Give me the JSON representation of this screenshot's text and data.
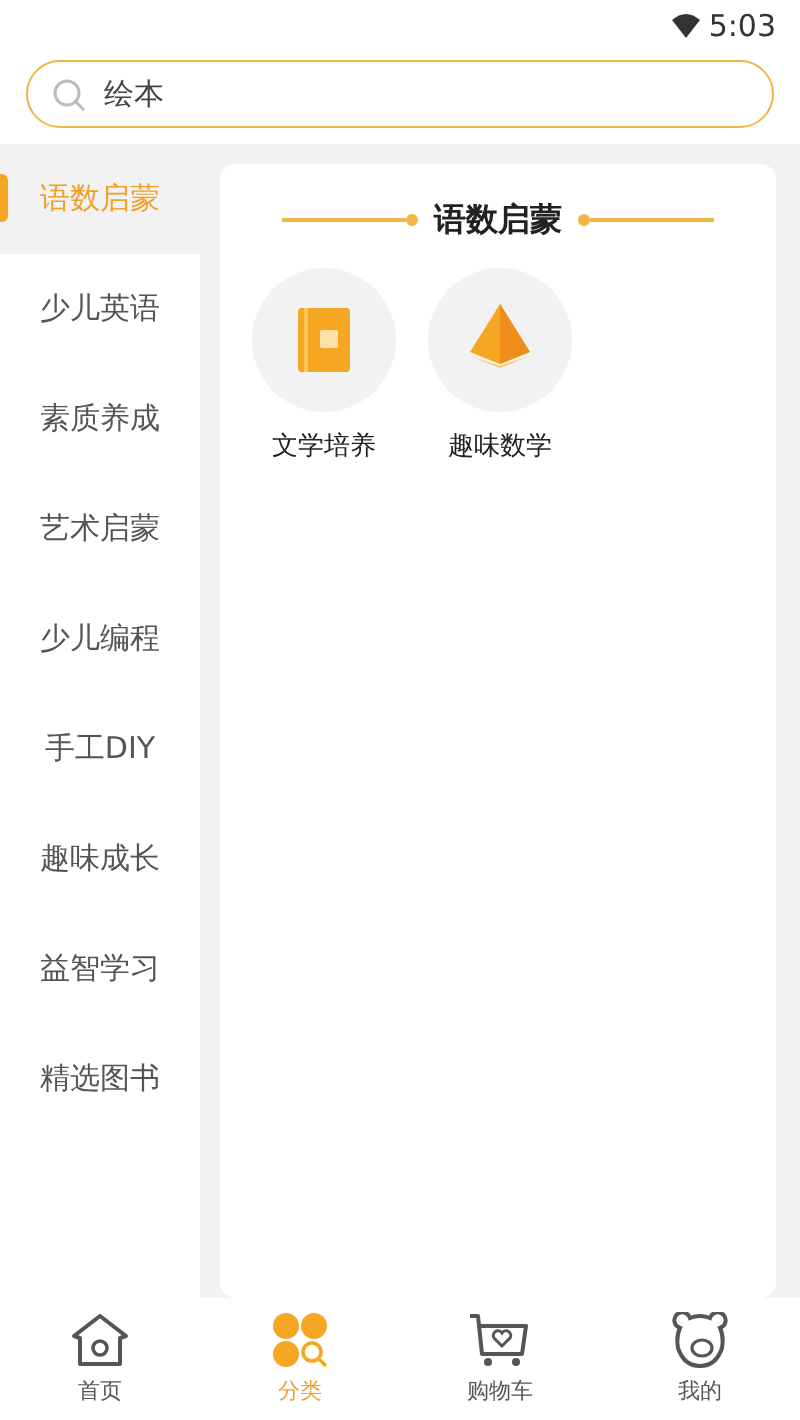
{
  "status_bar": {
    "time": "5:03"
  },
  "search": {
    "value": "绘本"
  },
  "sidebar": {
    "items": [
      {
        "label": "语数启蒙",
        "selected": true
      },
      {
        "label": "少儿英语",
        "selected": false
      },
      {
        "label": "素质养成",
        "selected": false
      },
      {
        "label": "艺术启蒙",
        "selected": false
      },
      {
        "label": "少儿编程",
        "selected": false
      },
      {
        "label": "手工DIY",
        "selected": false
      },
      {
        "label": "趣味成长",
        "selected": false
      },
      {
        "label": "益智学习",
        "selected": false
      },
      {
        "label": "精选图书",
        "selected": false
      }
    ]
  },
  "section": {
    "title": "语数启蒙",
    "items": [
      {
        "label": "文学培养",
        "kind": "book"
      },
      {
        "label": "趣味数学",
        "kind": "pyramid"
      }
    ]
  },
  "tab_bar": {
    "items": [
      {
        "label": "首页",
        "kind": "home",
        "selected": false
      },
      {
        "label": "分类",
        "kind": "category",
        "selected": true
      },
      {
        "label": "购物车",
        "kind": "cart",
        "selected": false
      },
      {
        "label": "我的",
        "kind": "bear",
        "selected": false
      }
    ]
  }
}
